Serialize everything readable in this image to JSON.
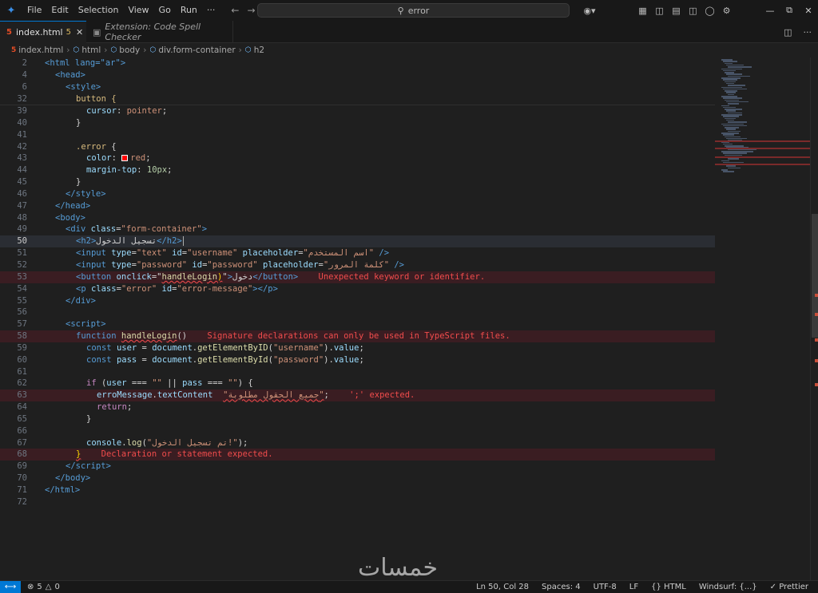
{
  "menu": [
    "File",
    "Edit",
    "Selection",
    "View",
    "Go",
    "Run",
    "···"
  ],
  "search": {
    "text": "error"
  },
  "tabs": {
    "active": {
      "name": "index.html",
      "count": "5"
    },
    "inactive": {
      "name": "Extension: Code Spell Checker"
    }
  },
  "breadcrumb": [
    "index.html",
    "html",
    "body",
    "div.form-container",
    "h2"
  ],
  "sticky": [
    {
      "num": "2",
      "text": "<html lang=\"ar\">"
    },
    {
      "num": "4",
      "text": "<head>"
    },
    {
      "num": "6",
      "text": "<style>"
    },
    {
      "num": "32",
      "text": "button {"
    }
  ],
  "code": {
    "l39": {
      "num": "39",
      "prop": "cursor",
      "value": "pointer"
    },
    "l40": {
      "num": "40"
    },
    "l41": {
      "num": "41"
    },
    "l42": {
      "num": "42",
      "selector": ".error"
    },
    "l43": {
      "num": "43",
      "prop": "color",
      "value": "red"
    },
    "l44": {
      "num": "44",
      "prop": "margin-top",
      "value": "10px"
    },
    "l45": {
      "num": "45"
    },
    "l46": {
      "num": "46"
    },
    "l47": {
      "num": "47"
    },
    "l48": {
      "num": "48"
    },
    "l49": {
      "num": "49",
      "class": "\"form-container\""
    },
    "l50": {
      "num": "50",
      "heading": "تسجيل الدخول"
    },
    "l51": {
      "num": "51",
      "type": "\"text\"",
      "id": "\"username\"",
      "placeholder": "\"اسم المستخدم\""
    },
    "l52": {
      "num": "52",
      "type": "\"password\"",
      "id": "\"password\"",
      "placeholder": "\"كلمة المرور\""
    },
    "l53": {
      "num": "53",
      "onclick": "handleLogin",
      "label": "دخول",
      "error": "Unexpected keyword or identifier."
    },
    "l54": {
      "num": "54",
      "class": "\"error\"",
      "id": "\"error-message\""
    },
    "l55": {
      "num": "55"
    },
    "l56": {
      "num": "56"
    },
    "l57": {
      "num": "57"
    },
    "l58": {
      "num": "58",
      "fn": "handleLogin",
      "error": "Signature declarations can only be used in TypeScript files."
    },
    "l59": {
      "num": "59",
      "var": "user",
      "call": "getElementByID",
      "arg": "\"username\""
    },
    "l60": {
      "num": "60",
      "var": "pass",
      "call": "getElementById",
      "arg": "\"password\""
    },
    "l61": {
      "num": "61"
    },
    "l62": {
      "num": "62"
    },
    "l63": {
      "num": "63",
      "obj": "erroMessage",
      "prop": "textContent",
      "str": "\"جميع الحقول مطلوبة\"",
      "error": "';' expected."
    },
    "l64": {
      "num": "64"
    },
    "l65": {
      "num": "65"
    },
    "l66": {
      "num": "66"
    },
    "l67": {
      "num": "67",
      "str": "\"تم تسجيل الدخول!\""
    },
    "l68": {
      "num": "68",
      "error": "Declaration or statement expected."
    },
    "l69": {
      "num": "69"
    },
    "l70": {
      "num": "70"
    },
    "l71": {
      "num": "71"
    },
    "l72": {
      "num": "72"
    }
  },
  "watermark": "خمسات",
  "status": {
    "errors": "5",
    "warnings": "0",
    "position": "Ln 50, Col 28",
    "spaces": "Spaces: 4",
    "encoding": "UTF-8",
    "eol": "LF",
    "language": "HTML",
    "windsurf": "Windsurf: {...}",
    "prettier": "Prettier"
  },
  "colors": {
    "accent": "#0078d4",
    "error": "#f14c4c",
    "background": "#1f1f1f"
  }
}
